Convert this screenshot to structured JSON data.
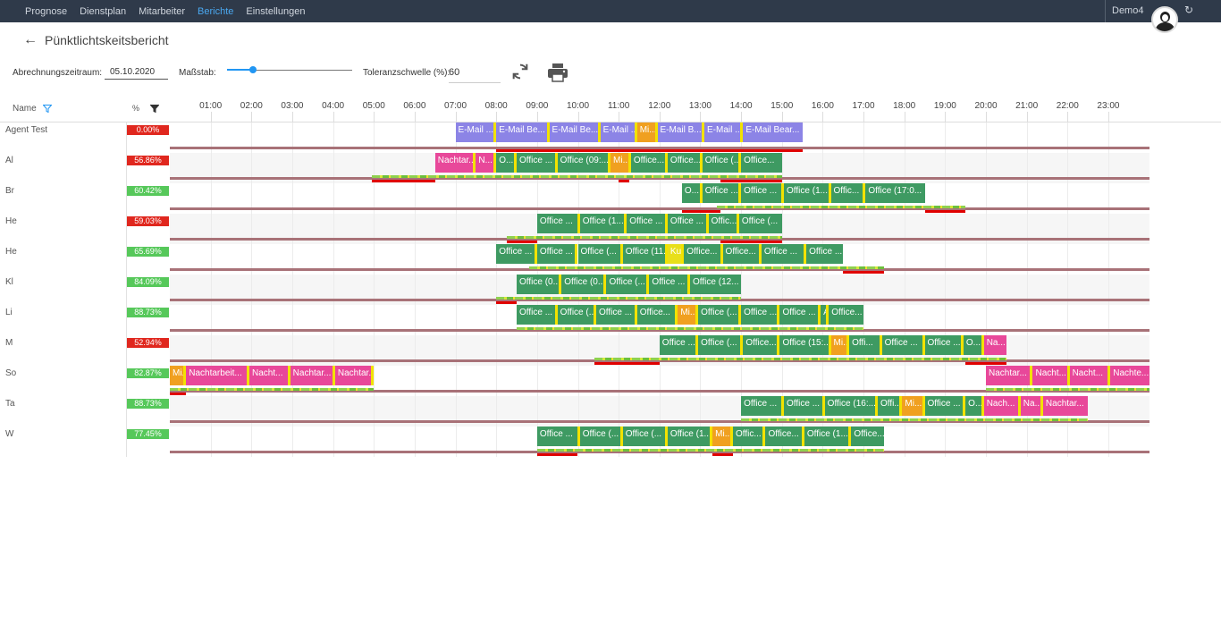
{
  "nav": {
    "items": [
      {
        "label": "Prognose",
        "active": false
      },
      {
        "label": "Dienstplan",
        "active": false
      },
      {
        "label": "Mitarbeiter",
        "active": false
      },
      {
        "label": "Berichte",
        "active": true
      },
      {
        "label": "Einstellungen",
        "active": false
      }
    ],
    "user": "Demo4"
  },
  "page": {
    "title": "Pünktlichtskeitsbericht"
  },
  "controls": {
    "period_label": "Abrechnungszeitraum:",
    "period_value": "05.10.2020",
    "scale_label": "Maßstab:",
    "scale_level": 0.2,
    "tolerance_label": "Toleranzschwelle (%):",
    "tolerance_value": "60"
  },
  "table": {
    "col_name": "Name",
    "col_pct": "%",
    "hours": [
      "01:00",
      "02:00",
      "03:00",
      "04:00",
      "05:00",
      "06:00",
      "07:00",
      "08:00",
      "09:00",
      "10:00",
      "11:00",
      "12:00",
      "13:00",
      "14:00",
      "15:00",
      "16:00",
      "17:00",
      "18:00",
      "19:00",
      "20:00",
      "21:00",
      "22:00",
      "23:00"
    ],
    "rows": [
      {
        "name": "Agent Test",
        "pct": "0.00%",
        "ok": false,
        "bars": [
          {
            "s": 7.0,
            "e": 8.0,
            "t": "E-Mail ...",
            "c": "#8c84e6"
          },
          {
            "s": 8.0,
            "e": 9.3,
            "t": "E-Mail Be...",
            "c": "#8c84e6"
          },
          {
            "s": 9.3,
            "e": 10.55,
            "t": "E-Mail Be...",
            "c": "#8c84e6"
          },
          {
            "s": 10.55,
            "e": 11.45,
            "t": "E-Mail ...",
            "c": "#8c84e6"
          },
          {
            "s": 11.45,
            "e": 11.95,
            "t": "Mi...",
            "c": "#f0a020"
          },
          {
            "s": 11.95,
            "e": 13.1,
            "t": "E-Mail B...",
            "c": "#8c84e6"
          },
          {
            "s": 13.1,
            "e": 14.05,
            "t": "E-Mail ...",
            "c": "#8c84e6"
          },
          {
            "s": 14.05,
            "e": 15.5,
            "t": "E-Mail Bear...",
            "c": "#8c84e6"
          }
        ],
        "tl": [],
        "red": [
          [
            8.0,
            15.5
          ]
        ]
      },
      {
        "name": "Al",
        "pct": "56.86%",
        "ok": false,
        "bars": [
          {
            "s": 6.5,
            "e": 7.5,
            "t": "Nachtar...",
            "c": "#e8489a"
          },
          {
            "s": 7.5,
            "e": 8.0,
            "t": "N...",
            "c": "#e8489a"
          },
          {
            "s": 8.0,
            "e": 8.5,
            "t": "O...",
            "c": "#3e9a62"
          },
          {
            "s": 8.5,
            "e": 9.5,
            "t": "Office ...",
            "c": "#3e9a62"
          },
          {
            "s": 9.5,
            "e": 10.8,
            "t": "Office (09:...",
            "c": "#3e9a62"
          },
          {
            "s": 10.8,
            "e": 11.3,
            "t": "Mi...",
            "c": "#f0a020"
          },
          {
            "s": 11.3,
            "e": 12.2,
            "t": "Office...",
            "c": "#3e9a62"
          },
          {
            "s": 12.2,
            "e": 13.05,
            "t": "Office...",
            "c": "#3e9a62"
          },
          {
            "s": 13.05,
            "e": 14.0,
            "t": "Office (...",
            "c": "#3e9a62"
          },
          {
            "s": 14.0,
            "e": 15.0,
            "t": "Office...",
            "c": "#3e9a62"
          }
        ],
        "tl": [
          [
            4.95,
            15.0
          ]
        ],
        "red": [
          [
            4.95,
            6.5
          ],
          [
            11.0,
            11.25
          ],
          [
            13.5,
            15.0
          ]
        ]
      },
      {
        "name": "Br",
        "pct": "60.42%",
        "ok": true,
        "bars": [
          {
            "s": 12.55,
            "e": 13.05,
            "t": "O...",
            "c": "#3e9a62"
          },
          {
            "s": 13.05,
            "e": 14.0,
            "t": "Office ...",
            "c": "#3e9a62"
          },
          {
            "s": 14.0,
            "e": 15.05,
            "t": "Office ...",
            "c": "#3e9a62"
          },
          {
            "s": 15.05,
            "e": 16.2,
            "t": "Office (1...",
            "c": "#3e9a62"
          },
          {
            "s": 16.2,
            "e": 17.05,
            "t": "Offic...",
            "c": "#3e9a62"
          },
          {
            "s": 17.05,
            "e": 18.5,
            "t": "Office (17:0...",
            "c": "#3e9a62"
          }
        ],
        "tl": [
          [
            13.4,
            19.5
          ]
        ],
        "red": [
          [
            12.55,
            13.5
          ],
          [
            18.5,
            19.5
          ]
        ]
      },
      {
        "name": "He",
        "pct": "59.03%",
        "ok": false,
        "bars": [
          {
            "s": 9.0,
            "e": 10.05,
            "t": "Office ...",
            "c": "#3e9a62"
          },
          {
            "s": 10.05,
            "e": 11.2,
            "t": "Office (1...",
            "c": "#3e9a62"
          },
          {
            "s": 11.2,
            "e": 12.2,
            "t": "Office ...",
            "c": "#3e9a62"
          },
          {
            "s": 12.2,
            "e": 13.2,
            "t": "Office ...",
            "c": "#3e9a62"
          },
          {
            "s": 13.2,
            "e": 13.95,
            "t": "Offic...",
            "c": "#3e9a62"
          },
          {
            "s": 13.95,
            "e": 15.0,
            "t": "Office (...",
            "c": "#3e9a62"
          }
        ],
        "tl": [
          [
            8.25,
            15.0
          ]
        ],
        "red": [
          [
            8.25,
            9.0
          ],
          [
            13.5,
            15.0
          ]
        ]
      },
      {
        "name": "He",
        "pct": "65.69%",
        "ok": true,
        "bars": [
          {
            "s": 8.0,
            "e": 9.0,
            "t": "Office ...",
            "c": "#3e9a62"
          },
          {
            "s": 9.0,
            "e": 10.0,
            "t": "Office ...",
            "c": "#3e9a62"
          },
          {
            "s": 10.0,
            "e": 11.1,
            "t": "Office (...",
            "c": "#3e9a62"
          },
          {
            "s": 11.1,
            "e": 12.2,
            "t": "Office (11...",
            "c": "#3e9a62"
          },
          {
            "s": 12.2,
            "e": 12.6,
            "t": "Ku...",
            "c": "#e8df1a"
          },
          {
            "s": 12.6,
            "e": 13.55,
            "t": "Office...",
            "c": "#3e9a62"
          },
          {
            "s": 13.55,
            "e": 14.5,
            "t": "Office...",
            "c": "#3e9a62"
          },
          {
            "s": 14.5,
            "e": 15.6,
            "t": "Office ...",
            "c": "#3e9a62"
          },
          {
            "s": 15.6,
            "e": 16.5,
            "t": "Office ...",
            "c": "#3e9a62"
          }
        ],
        "tl": [
          [
            8.8,
            17.5
          ]
        ],
        "red": [
          [
            16.5,
            17.5
          ]
        ]
      },
      {
        "name": "Kl",
        "pct": "84.09%",
        "ok": true,
        "bars": [
          {
            "s": 8.5,
            "e": 9.6,
            "t": "Office (0...",
            "c": "#3e9a62"
          },
          {
            "s": 9.6,
            "e": 10.7,
            "t": "Office (0...",
            "c": "#3e9a62"
          },
          {
            "s": 10.7,
            "e": 11.75,
            "t": "Office (...",
            "c": "#3e9a62"
          },
          {
            "s": 11.75,
            "e": 12.75,
            "t": "Office ...",
            "c": "#3e9a62"
          },
          {
            "s": 12.75,
            "e": 14.0,
            "t": "Office (12...",
            "c": "#3e9a62"
          }
        ],
        "tl": [
          [
            8.0,
            14.0
          ]
        ],
        "red": [
          [
            8.0,
            8.5
          ]
        ]
      },
      {
        "name": "Li",
        "pct": "88.73%",
        "ok": true,
        "bars": [
          {
            "s": 8.5,
            "e": 9.5,
            "t": "Office ...",
            "c": "#3e9a62"
          },
          {
            "s": 9.5,
            "e": 10.45,
            "t": "Office (...",
            "c": "#3e9a62"
          },
          {
            "s": 10.45,
            "e": 11.45,
            "t": "Office ...",
            "c": "#3e9a62"
          },
          {
            "s": 11.45,
            "e": 12.45,
            "t": "Office...",
            "c": "#3e9a62"
          },
          {
            "s": 12.45,
            "e": 12.95,
            "t": "Mi...",
            "c": "#f0a020"
          },
          {
            "s": 12.95,
            "e": 14.0,
            "t": "Office (...",
            "c": "#3e9a62"
          },
          {
            "s": 14.0,
            "e": 14.95,
            "t": "Office ...",
            "c": "#3e9a62"
          },
          {
            "s": 14.95,
            "e": 15.95,
            "t": "Office ...",
            "c": "#3e9a62"
          },
          {
            "s": 15.95,
            "e": 16.15,
            "t": "A",
            "c": "#3e9a62"
          },
          {
            "s": 16.15,
            "e": 17.0,
            "t": "Office...",
            "c": "#3e9a62"
          }
        ],
        "tl": [
          [
            8.5,
            17.0
          ]
        ],
        "red": []
      },
      {
        "name": "M",
        "pct": "52.94%",
        "ok": false,
        "bars": [
          {
            "s": 12.0,
            "e": 12.95,
            "t": "Office ...",
            "c": "#3e9a62"
          },
          {
            "s": 12.95,
            "e": 14.05,
            "t": "Office (...",
            "c": "#3e9a62"
          },
          {
            "s": 14.05,
            "e": 14.95,
            "t": "Office...",
            "c": "#3e9a62"
          },
          {
            "s": 14.95,
            "e": 16.2,
            "t": "Office (15:...",
            "c": "#3e9a62"
          },
          {
            "s": 16.2,
            "e": 16.65,
            "t": "Mi...",
            "c": "#f0a020"
          },
          {
            "s": 16.65,
            "e": 17.45,
            "t": "Offi...",
            "c": "#3e9a62"
          },
          {
            "s": 17.45,
            "e": 18.5,
            "t": "Office ...",
            "c": "#3e9a62"
          },
          {
            "s": 18.5,
            "e": 19.45,
            "t": "Office ...",
            "c": "#3e9a62"
          },
          {
            "s": 19.45,
            "e": 19.95,
            "t": "O...",
            "c": "#3e9a62"
          },
          {
            "s": 19.95,
            "e": 20.5,
            "t": "Na...",
            "c": "#e8489a"
          }
        ],
        "tl": [
          [
            10.4,
            20.5
          ]
        ],
        "red": [
          [
            10.4,
            12.0
          ],
          [
            19.5,
            20.5
          ]
        ]
      },
      {
        "name": "So",
        "pct": "82.87%",
        "ok": true,
        "bars": [
          {
            "s": 0.0,
            "e": 0.4,
            "t": "Mi...",
            "c": "#f0a020"
          },
          {
            "s": 0.4,
            "e": 1.95,
            "t": "Nachtarbeit...",
            "c": "#e8489a"
          },
          {
            "s": 1.95,
            "e": 2.95,
            "t": "Nacht...",
            "c": "#e8489a"
          },
          {
            "s": 2.95,
            "e": 4.05,
            "t": "Nachtar...",
            "c": "#e8489a"
          },
          {
            "s": 4.05,
            "e": 5.0,
            "t": "Nachtar...",
            "c": "#e8489a"
          },
          {
            "s": 20.0,
            "e": 21.15,
            "t": "Nachtar...",
            "c": "#e8489a"
          },
          {
            "s": 21.15,
            "e": 22.05,
            "t": "Nacht...",
            "c": "#e8489a"
          },
          {
            "s": 22.05,
            "e": 23.05,
            "t": "Nacht...",
            "c": "#e8489a"
          },
          {
            "s": 23.05,
            "e": 24.0,
            "t": "Nachte...",
            "c": "#e8489a"
          }
        ],
        "tl": [
          [
            0.0,
            5.0
          ],
          [
            20.0,
            24.0
          ]
        ],
        "red": [
          [
            0.0,
            0.4
          ]
        ]
      },
      {
        "name": "Ta",
        "pct": "88.73%",
        "ok": true,
        "bars": [
          {
            "s": 14.0,
            "e": 15.05,
            "t": "Office ...",
            "c": "#3e9a62"
          },
          {
            "s": 15.05,
            "e": 16.05,
            "t": "Office ...",
            "c": "#3e9a62"
          },
          {
            "s": 16.05,
            "e": 17.35,
            "t": "Office (16:...",
            "c": "#3e9a62"
          },
          {
            "s": 17.35,
            "e": 17.95,
            "t": "Offi...",
            "c": "#3e9a62"
          },
          {
            "s": 17.95,
            "e": 18.5,
            "t": "Mi...",
            "c": "#f0a020"
          },
          {
            "s": 18.5,
            "e": 19.5,
            "t": "Office ...",
            "c": "#3e9a62"
          },
          {
            "s": 19.5,
            "e": 19.95,
            "t": "O...",
            "c": "#3e9a62"
          },
          {
            "s": 19.95,
            "e": 20.85,
            "t": "Nach...",
            "c": "#e8489a"
          },
          {
            "s": 20.85,
            "e": 21.4,
            "t": "Na...",
            "c": "#e8489a"
          },
          {
            "s": 21.4,
            "e": 22.5,
            "t": "Nachtar...",
            "c": "#e8489a"
          }
        ],
        "tl": [
          [
            14.0,
            22.5
          ]
        ],
        "red": []
      },
      {
        "name": "W",
        "pct": "77.45%",
        "ok": true,
        "bars": [
          {
            "s": 9.0,
            "e": 10.05,
            "t": "Office ...",
            "c": "#3e9a62"
          },
          {
            "s": 10.05,
            "e": 11.1,
            "t": "Office (...",
            "c": "#3e9a62"
          },
          {
            "s": 11.1,
            "e": 12.2,
            "t": "Office (...",
            "c": "#3e9a62"
          },
          {
            "s": 12.2,
            "e": 13.3,
            "t": "Office (1...",
            "c": "#3e9a62"
          },
          {
            "s": 13.3,
            "e": 13.8,
            "t": "Mi...",
            "c": "#f0a020"
          },
          {
            "s": 13.8,
            "e": 14.6,
            "t": "Offic...",
            "c": "#3e9a62"
          },
          {
            "s": 14.6,
            "e": 15.55,
            "t": "Office...",
            "c": "#3e9a62"
          },
          {
            "s": 15.55,
            "e": 16.7,
            "t": "Office (1...",
            "c": "#3e9a62"
          },
          {
            "s": 16.7,
            "e": 17.5,
            "t": "Office...",
            "c": "#3e9a62"
          }
        ],
        "tl": [
          [
            9.0,
            17.5
          ]
        ],
        "red": [
          [
            9.0,
            10.0
          ],
          [
            13.3,
            13.8
          ]
        ]
      }
    ]
  },
  "colors": {
    "pct_ok": "#56c85a",
    "pct_bad": "#e0271e",
    "accent": "#2196f3",
    "nav_bg": "#2f3a4a"
  }
}
